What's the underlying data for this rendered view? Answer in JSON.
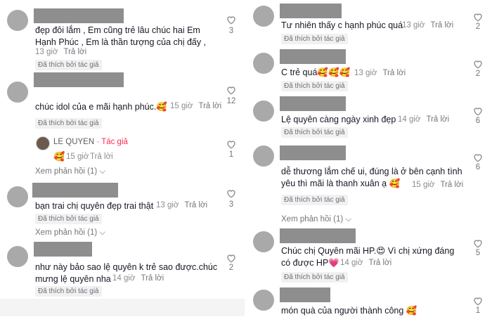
{
  "common": {
    "liked_by_author": "Đã thích bởi tác giả",
    "reply": "Trả lời",
    "view_replies": "Xem phản hồi (1)",
    "chevron": "chevron-down-icon",
    "heart_icon": "heart-outline-icon"
  },
  "left": [
    {
      "text": "đẹp đôi lắm , Em cũng trẻ lâu chúc hai Em\nHạnh Phúc , Em là thần tượng của chị đấy ,",
      "time": "13 giờ",
      "likes": "3"
    },
    {
      "text": "chúc idol của e mãi hạnh phúc.🥰",
      "time": "15 giờ",
      "likes": "12",
      "reply": {
        "author": "LE QUYEN",
        "tag": "· Tác giả",
        "text": "🥰",
        "time": "15 giờ",
        "likes": "1"
      }
    },
    {
      "text": "bạn trai chị quyên đẹp trai thật",
      "time": "13 giờ",
      "likes": "3"
    },
    {
      "text": "như này bảo sao lệ quyên k trẻ sao được.chúc\nmưng lệ quyên nha",
      "time": "14 giờ",
      "likes": "2"
    }
  ],
  "right": [
    {
      "text": "Tư nhiên thấy c hạnh phúc quá",
      "time": "13 giờ",
      "likes": "2"
    },
    {
      "text": "C trẻ quá🥰🥰🥰",
      "time": "13 giờ",
      "likes": "2"
    },
    {
      "text": "Lệ quyên càng ngày xinh đẹp",
      "time": "14 giờ",
      "likes": "6"
    },
    {
      "text": "dễ thương lắm chế ui, đúng là ở bên cạnh tình\nyêu thì mãi là thanh xuân ạ 🥰",
      "time": "15 giờ",
      "likes": "6"
    },
    {
      "text": "Chúc chị Quyên mãi HP.😍  Vì chị xứng đáng\ncó được HP💗",
      "time": "14 giờ",
      "likes": "5"
    },
    {
      "text": "món quà của người thành công 🥰",
      "time": "",
      "likes": "1"
    }
  ]
}
